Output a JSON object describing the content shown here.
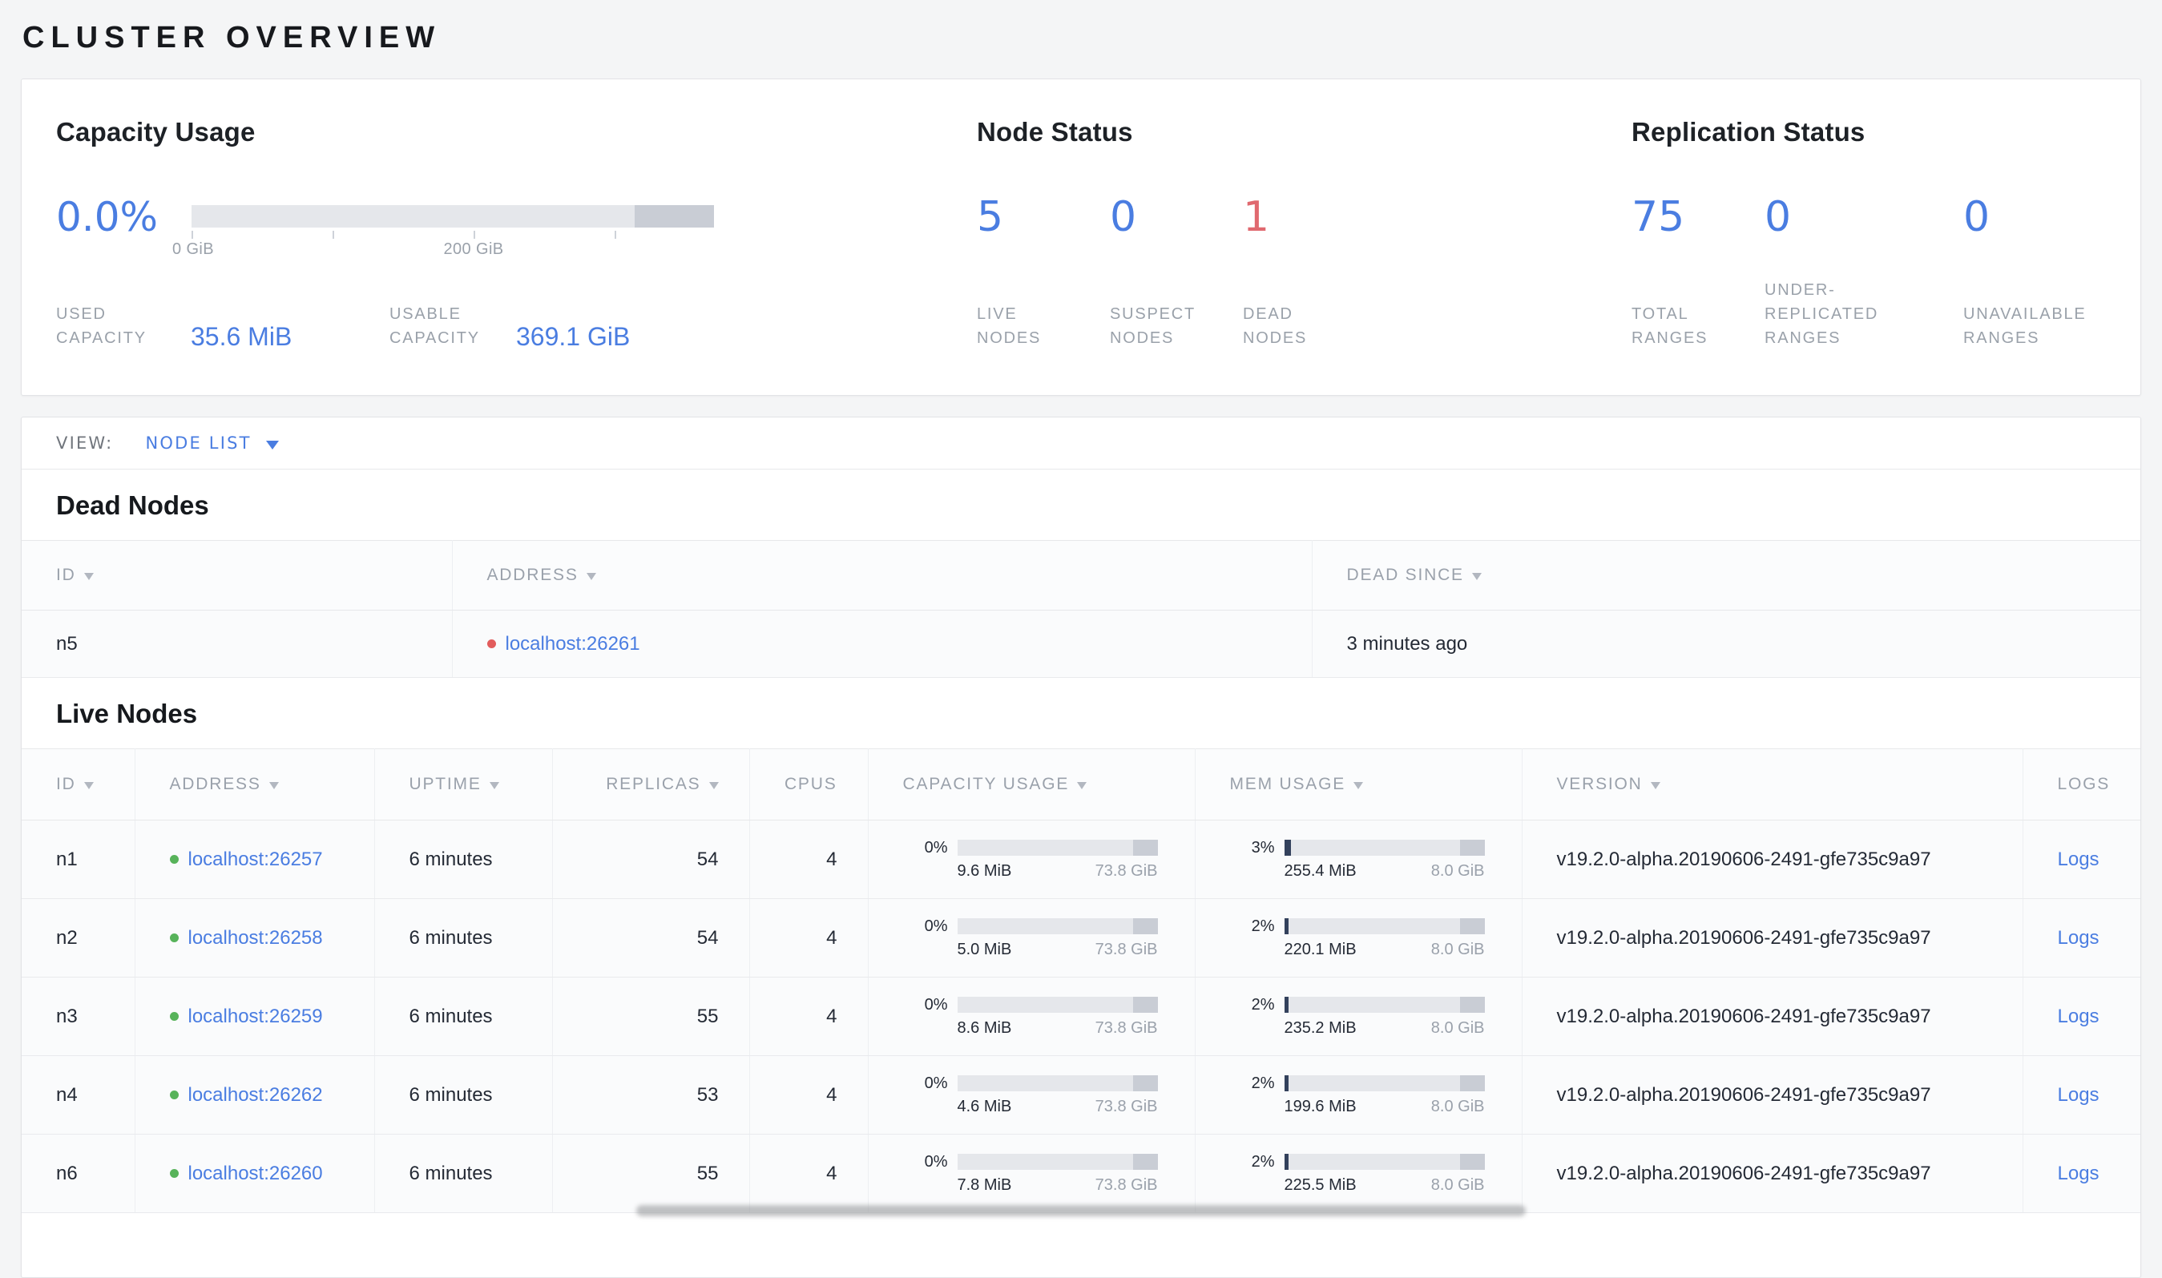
{
  "page": {
    "title": "CLUSTER OVERVIEW"
  },
  "colors": {
    "accent_blue": "#4a7de1",
    "dead_red": "#e0696f",
    "live_green": "#57b35a",
    "bar_track": "#e5e7eb",
    "bar_reserved": "#c9cdd5",
    "bar_used": "#33415c"
  },
  "summary": {
    "capacity": {
      "title": "Capacity Usage",
      "percent": "0.0%",
      "axis_ticks": [
        "0 GiB",
        "200 GiB"
      ],
      "used_label": "USED CAPACITY",
      "used_value": "35.6 MiB",
      "usable_label": "USABLE CAPACITY",
      "usable_value": "369.1 GiB"
    },
    "node_status": {
      "title": "Node Status",
      "stats": [
        {
          "value": "5",
          "label": "LIVE NODES",
          "color": "blue"
        },
        {
          "value": "0",
          "label": "SUSPECT NODES",
          "color": "blue"
        },
        {
          "value": "1",
          "label": "DEAD NODES",
          "color": "red"
        }
      ]
    },
    "replication": {
      "title": "Replication Status",
      "stats": [
        {
          "value": "75",
          "label": "TOTAL RANGES",
          "color": "blue"
        },
        {
          "value": "0",
          "label": "UNDER-REPLICATED RANGES",
          "color": "blue"
        },
        {
          "value": "0",
          "label": "UNAVAILABLE RANGES",
          "color": "blue"
        }
      ]
    }
  },
  "view_bar": {
    "label": "VIEW:",
    "selected": "NODE LIST"
  },
  "dead_nodes": {
    "title": "Dead Nodes",
    "columns": [
      {
        "label": "ID",
        "sortable": true
      },
      {
        "label": "ADDRESS",
        "sortable": true
      },
      {
        "label": "DEAD SINCE",
        "sortable": true
      }
    ],
    "rows": [
      {
        "id": "n5",
        "address": "localhost:26261",
        "dead_since": "3 minutes ago"
      }
    ]
  },
  "live_nodes": {
    "title": "Live Nodes",
    "columns": [
      {
        "label": "ID",
        "sortable": true
      },
      {
        "label": "ADDRESS",
        "sortable": true
      },
      {
        "label": "UPTIME",
        "sortable": true
      },
      {
        "label": "REPLICAS",
        "sortable": true,
        "align": "right"
      },
      {
        "label": "CPUS",
        "sortable": false,
        "align": "right"
      },
      {
        "label": "CAPACITY USAGE",
        "sortable": true
      },
      {
        "label": "MEM USAGE",
        "sortable": true
      },
      {
        "label": "VERSION",
        "sortable": true
      },
      {
        "label": "LOGS",
        "sortable": false
      }
    ],
    "rows": [
      {
        "id": "n1",
        "address": "localhost:26257",
        "uptime": "6 minutes",
        "replicas": "54",
        "cpus": "4",
        "capacity_percent": "0%",
        "capacity_used": "9.6 MiB",
        "capacity_total": "73.8 GiB",
        "mem_percent": "3%",
        "mem_used": "255.4 MiB",
        "mem_total": "8.0 GiB",
        "version": "v19.2.0-alpha.20190606-2491-gfe735c9a97",
        "logs": "Logs"
      },
      {
        "id": "n2",
        "address": "localhost:26258",
        "uptime": "6 minutes",
        "replicas": "54",
        "cpus": "4",
        "capacity_percent": "0%",
        "capacity_used": "5.0 MiB",
        "capacity_total": "73.8 GiB",
        "mem_percent": "2%",
        "mem_used": "220.1 MiB",
        "mem_total": "8.0 GiB",
        "version": "v19.2.0-alpha.20190606-2491-gfe735c9a97",
        "logs": "Logs"
      },
      {
        "id": "n3",
        "address": "localhost:26259",
        "uptime": "6 minutes",
        "replicas": "55",
        "cpus": "4",
        "capacity_percent": "0%",
        "capacity_used": "8.6 MiB",
        "capacity_total": "73.8 GiB",
        "mem_percent": "2%",
        "mem_used": "235.2 MiB",
        "mem_total": "8.0 GiB",
        "version": "v19.2.0-alpha.20190606-2491-gfe735c9a97",
        "logs": "Logs"
      },
      {
        "id": "n4",
        "address": "localhost:26262",
        "uptime": "6 minutes",
        "replicas": "53",
        "cpus": "4",
        "capacity_percent": "0%",
        "capacity_used": "4.6 MiB",
        "capacity_total": "73.8 GiB",
        "mem_percent": "2%",
        "mem_used": "199.6 MiB",
        "mem_total": "8.0 GiB",
        "version": "v19.2.0-alpha.20190606-2491-gfe735c9a97",
        "logs": "Logs"
      },
      {
        "id": "n6",
        "address": "localhost:26260",
        "uptime": "6 minutes",
        "replicas": "55",
        "cpus": "4",
        "capacity_percent": "0%",
        "capacity_used": "7.8 MiB",
        "capacity_total": "73.8 GiB",
        "mem_percent": "2%",
        "mem_used": "225.5 MiB",
        "mem_total": "8.0 GiB",
        "version": "v19.2.0-alpha.20190606-2491-gfe735c9a97",
        "logs": "Logs"
      }
    ]
  }
}
